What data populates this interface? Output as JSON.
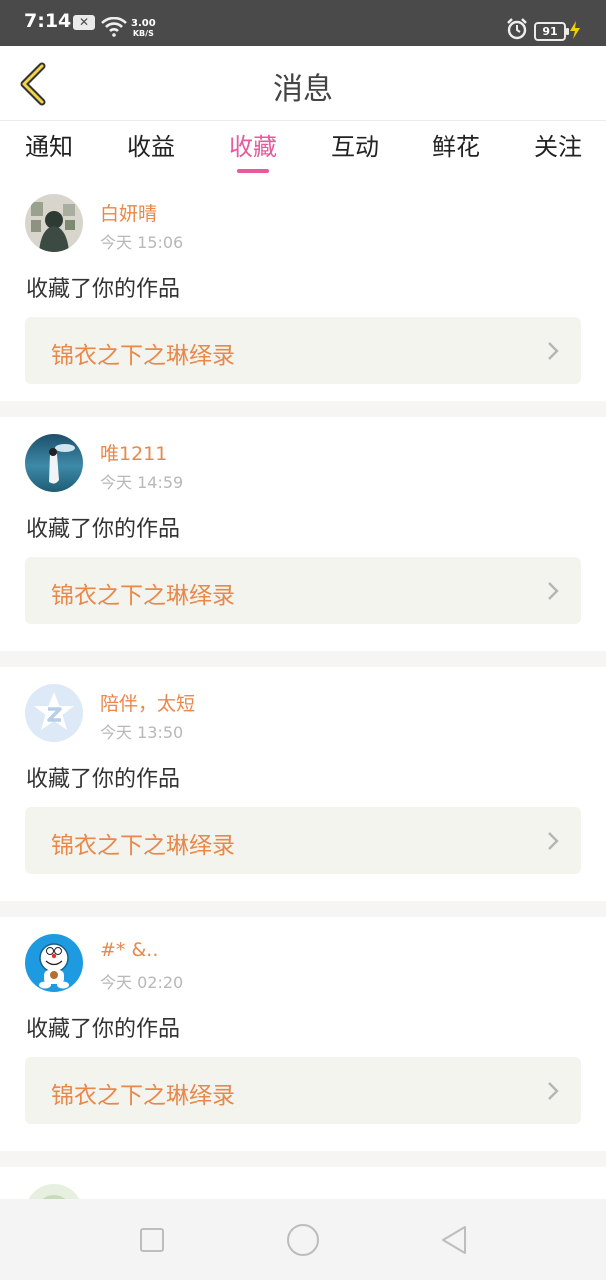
{
  "status_bar": {
    "time": "7:14",
    "net_speed_value": "3.00",
    "net_speed_unit": "KB/S",
    "battery": "91",
    "icons": [
      "close-box-icon",
      "wifi-icon",
      "alarm-icon",
      "battery-icon",
      "charging-bolt-icon"
    ]
  },
  "header": {
    "title": "消息",
    "back_icon": "chevron-left-icon"
  },
  "tabs": [
    {
      "label": "通知",
      "active": false
    },
    {
      "label": "收益",
      "active": false
    },
    {
      "label": "收藏",
      "active": true
    },
    {
      "label": "互动",
      "active": false
    },
    {
      "label": "鲜花",
      "active": false
    },
    {
      "label": "关注",
      "active": false
    }
  ],
  "messages": [
    {
      "user": "白妍晴",
      "time": "今天 15:06",
      "action": "收藏了你的作品",
      "work": "锦衣之下之琳绎录",
      "avatar": "photo-avatar-icon"
    },
    {
      "user": "唯1211",
      "time": "今天 14:59",
      "action": "收藏了你的作品",
      "work": "锦衣之下之琳绎录",
      "avatar": "photo-avatar-icon"
    },
    {
      "user": "陪伴，太短",
      "time": "今天 13:50",
      "action": "收藏了你的作品",
      "work": "锦衣之下之琳绎录",
      "avatar": "qq-star-avatar-icon"
    },
    {
      "user": "#* &..",
      "time": "今天 02:20",
      "action": "收藏了你的作品",
      "work": "锦衣之下之琳绎录",
      "avatar": "doraemon-avatar-icon"
    }
  ],
  "nav_bar": {
    "icons": [
      "recent-apps-icon",
      "home-icon",
      "back-triangle-icon"
    ]
  },
  "colors": {
    "accent": "#e85a9b",
    "orange": "#e8884a",
    "card_bg": "#f4f4ee"
  }
}
